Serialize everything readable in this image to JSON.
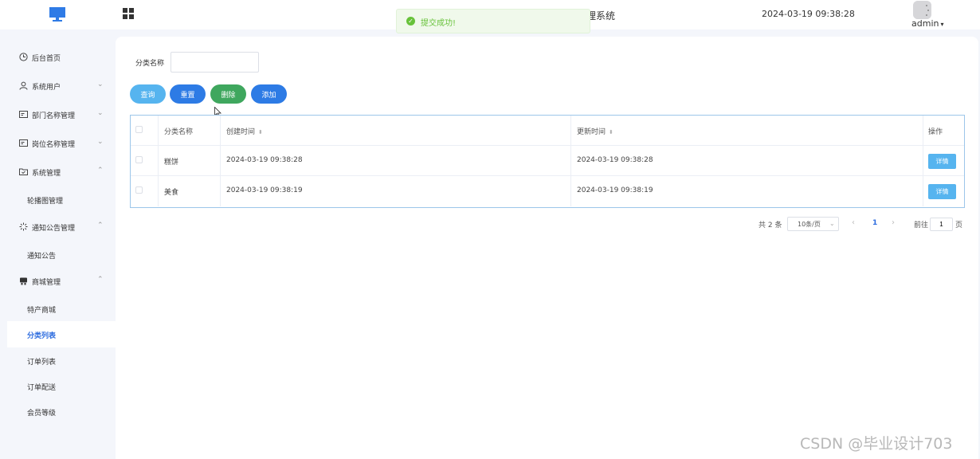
{
  "header": {
    "system_title": "理系统",
    "datetime": "2024-03-19 09:38:28",
    "user": "admin",
    "user_caret": "▾"
  },
  "toast": {
    "message": "提交成功!",
    "icon": "check-circle-icon"
  },
  "sidebar": {
    "items": [
      {
        "label": "后台首页",
        "icon": "clock-icon",
        "arrow": ""
      },
      {
        "label": "系统用户",
        "icon": "user-icon",
        "arrow": "⌄"
      },
      {
        "label": "部门名称管理",
        "icon": "card-icon",
        "arrow": "⌄"
      },
      {
        "label": "岗位名称管理",
        "icon": "card-icon",
        "arrow": "⌄"
      },
      {
        "label": "系统管理",
        "icon": "folder-icon",
        "arrow": "⌃"
      },
      {
        "label": "轮播图管理"
      },
      {
        "label": "通知公告管理",
        "icon": "spinner-icon",
        "arrow": "⌃"
      },
      {
        "label": "通知公告"
      },
      {
        "label": "商城管理",
        "icon": "shop-icon",
        "arrow": "⌃"
      },
      {
        "label": "特产商城"
      },
      {
        "label": "分类列表",
        "active": true
      },
      {
        "label": "订单列表"
      },
      {
        "label": "订单配送"
      },
      {
        "label": "会员等级"
      }
    ]
  },
  "filter": {
    "label": "分类名称",
    "value": "",
    "placeholder": ""
  },
  "buttons": {
    "query": "查询",
    "reset": "重置",
    "delete": "删除",
    "add": "添加"
  },
  "table": {
    "headers": {
      "name": "分类名称",
      "created": "创建时间",
      "updated": "更新时间",
      "operation": "操作",
      "sort_icon": "⬍"
    },
    "rows": [
      {
        "name": "糕饼",
        "created": "2024-03-19 09:38:28",
        "updated": "2024-03-19 09:38:28",
        "action": "详情"
      },
      {
        "name": "美食",
        "created": "2024-03-19 09:38:19",
        "updated": "2024-03-19 09:38:19",
        "action": "详情"
      }
    ]
  },
  "pagination": {
    "total": "共 2 条",
    "page_size": "10条/页",
    "page_size_arrow": "⌄",
    "prev": "‹",
    "current": "1",
    "next": "›",
    "goto_label": "前往",
    "goto_value": "1",
    "page_suffix": "页"
  },
  "watermark": "CSDN @毕业设计703"
}
